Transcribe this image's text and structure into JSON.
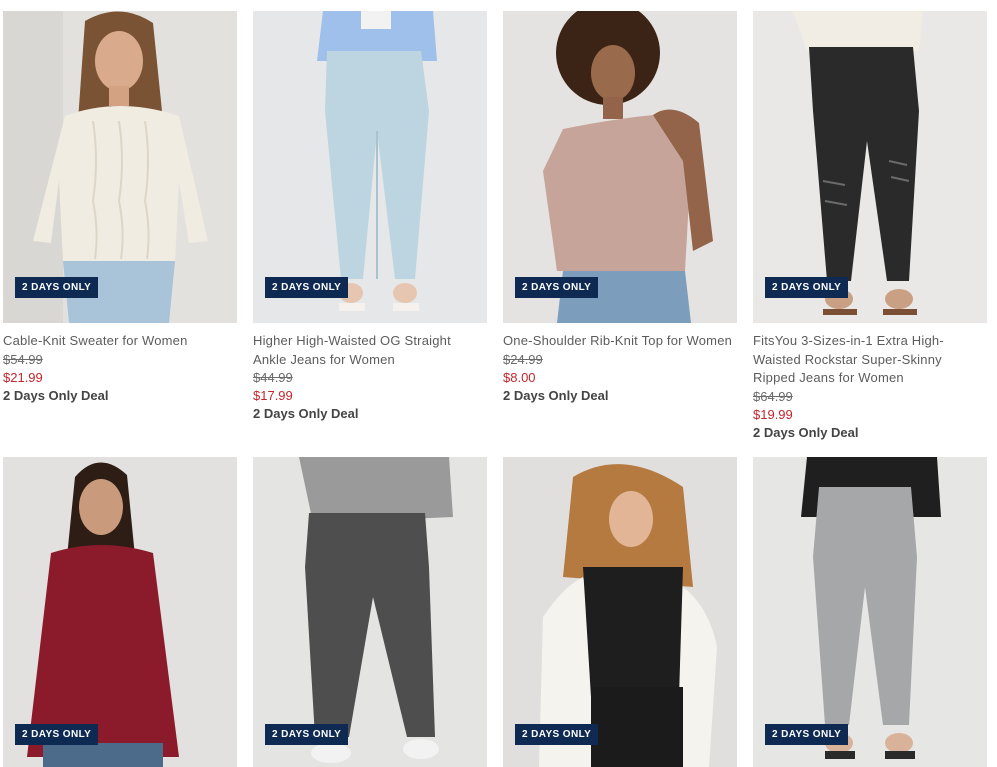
{
  "badge_colors": {
    "background": "#0e2a52",
    "text": "#ffffff",
    "sale_price": "#c4252b"
  },
  "products": [
    {
      "badge": "2 DAYS ONLY",
      "title": "Cable-Knit Sweater for Women",
      "was": "$54.99",
      "now": "$21.99",
      "deal": "2 Days Only Deal",
      "image": "cream-cable-knit-sweater"
    },
    {
      "badge": "2 DAYS ONLY",
      "title": "Higher High-Waisted OG Straight Ankle Jeans for Women",
      "was": "$44.99",
      "now": "$17.99",
      "deal": "2 Days Only Deal",
      "image": "light-wash-straight-jeans"
    },
    {
      "badge": "2 DAYS ONLY",
      "title": "One-Shoulder Rib-Knit Top for Women",
      "was": "$24.99",
      "now": "$8.00",
      "deal": "2 Days Only Deal",
      "image": "blush-one-shoulder-top"
    },
    {
      "badge": "2 DAYS ONLY",
      "title": "FitsYou 3-Sizes-in-1 Extra High-Waisted Rockstar Super-Skinny Ripped Jeans for Women",
      "was": "$64.99",
      "now": "$19.99",
      "deal": "2 Days Only Deal",
      "image": "black-ripped-skinny-jeans"
    },
    {
      "badge": "2 DAYS ONLY",
      "image": "burgundy-mock-neck-tunic"
    },
    {
      "badge": "2 DAYS ONLY",
      "image": "charcoal-flare-pants"
    },
    {
      "badge": "2 DAYS ONLY",
      "image": "black-satin-cami"
    },
    {
      "badge": "2 DAYS ONLY",
      "image": "gray-pixie-pants"
    }
  ]
}
